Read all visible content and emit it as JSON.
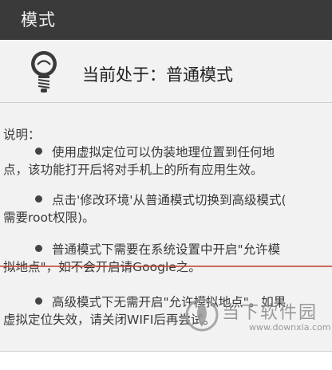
{
  "titlebar": {
    "title": "模式"
  },
  "mode": {
    "label": "当前处于：普通模式",
    "icon": "lightbulb-icon"
  },
  "info": {
    "intro": "说明：",
    "paragraphs": [
      {
        "line1": "使用虚拟定位可以伪装地理位置到任何地",
        "line2": "点，该功能打开后将对手机上的所有应用生效。"
      },
      {
        "line1": "点击'修改环境'从普通模式切换到高级模式(",
        "line2": "需要root权限)。"
      },
      {
        "line1": "普通模式下需要在系统设置中开启\"允许模",
        "line2": "拟地点\"，如不会开启请Google之。"
      },
      {
        "line1": "高级模式下无需开启\"允许模拟地点\"。如果",
        "line2": "虚拟定位失效，请关闭WIFI后再尝试。"
      }
    ]
  },
  "watermark": {
    "text": "当下软件园",
    "url": "www.downxia.com"
  },
  "colors": {
    "titlebar": "#3a3a3a",
    "background": "#f2f2f2",
    "accent_line": "#c0392b"
  }
}
